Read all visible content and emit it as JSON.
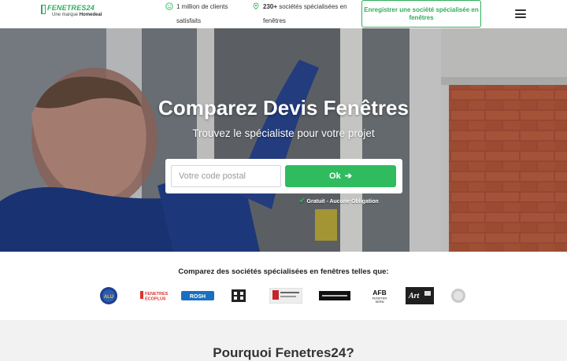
{
  "header": {
    "logo_name": "FENETRES24",
    "logo_sub_prefix": "Une marque",
    "logo_sub_brand": "Homedeal",
    "stats": [
      {
        "icon": "smile-icon",
        "bold": "",
        "text": "1 million de clients satisfaits"
      },
      {
        "icon": "location-pin-icon",
        "bold": "230+",
        "text": " sociétés spécialisées en fenêtres"
      }
    ],
    "register_label": "Enregistrer une société spécialisée en fenêtres",
    "menu_icon": "hamburger-menu-icon"
  },
  "hero": {
    "title": "Comparez Devis Fenêtres",
    "subtitle": "Trouvez le spécialiste pour votre projet",
    "postal_placeholder": "Votre code postal",
    "postal_value": "",
    "ok_label": "Ok",
    "free_note": "Gratuit - Aucune Obligation"
  },
  "partners": {
    "title": "Comparez des sociétés spécialisées en fenêtres telles que:",
    "logos": [
      {
        "name": "ALU",
        "icon": "alu-logo"
      },
      {
        "name": "FENETRES ECOPLUS",
        "icon": "fenetres-ecoplus-logo"
      },
      {
        "name": "ROSH",
        "icon": "rosh-logo"
      },
      {
        "name": "",
        "icon": "building-logo"
      },
      {
        "name": "",
        "icon": "menuiserie-logo"
      },
      {
        "name": "",
        "icon": "dark-banner-logo"
      },
      {
        "name": "AFB FENSTER SERN",
        "icon": "afb-logo"
      },
      {
        "name": "Art",
        "icon": "art-logo"
      },
      {
        "name": "",
        "icon": "round-grey-logo"
      }
    ]
  },
  "why": {
    "title": "Pourquoi Fenetres24?"
  },
  "colors": {
    "brand_green": "#2fbb5e",
    "text_dark": "#222222"
  }
}
